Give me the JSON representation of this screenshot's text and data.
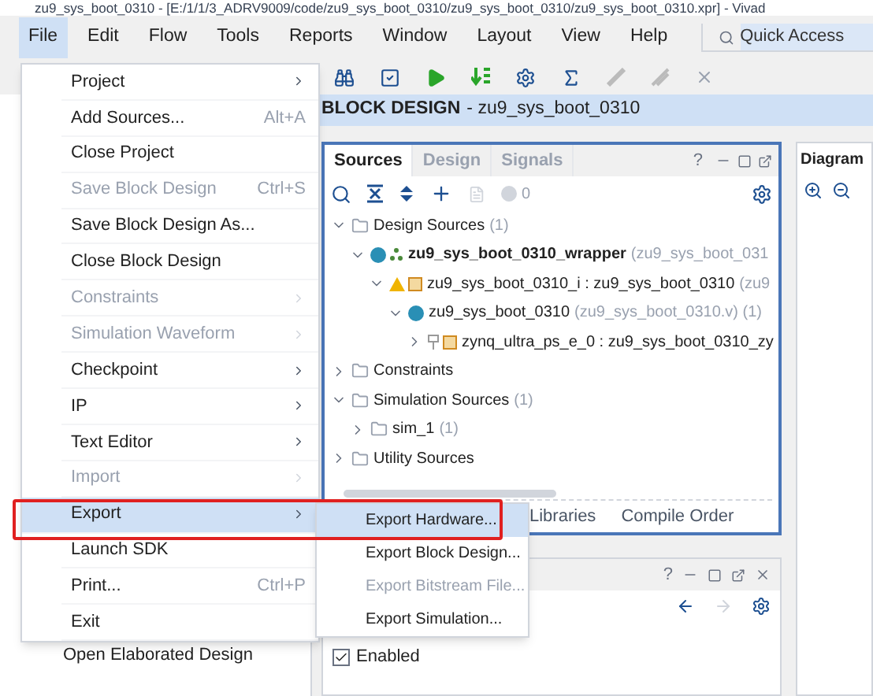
{
  "window": {
    "title": "zu9_sys_boot_0310 - [E:/1/1/3_ADRV9009/code/zu9_sys_boot_0310/zu9_sys_boot_0310/zu9_sys_boot_0310.xpr] - Vivad"
  },
  "menu_bar": [
    {
      "label": "File",
      "selected": true
    },
    {
      "label": "Edit",
      "selected": false
    },
    {
      "label": "Flow",
      "selected": false
    },
    {
      "label": "Tools",
      "selected": false
    },
    {
      "label": "Reports",
      "selected": false
    },
    {
      "label": "Window",
      "selected": false
    },
    {
      "label": "Layout",
      "selected": false
    },
    {
      "label": "View",
      "selected": false
    },
    {
      "label": "Help",
      "selected": false
    }
  ],
  "quick_access": {
    "placeholder": "Quick Access"
  },
  "block_design_header": {
    "title": "BLOCK DESIGN",
    "name": "- zu9_sys_boot_0310"
  },
  "flow_navigator": {
    "visible_item": "Open Elaborated Design"
  },
  "file_menu": [
    {
      "label": "Project",
      "submenu": true,
      "disabled": false,
      "selected": false
    },
    {
      "label": "Add Sources...",
      "shortcut": "Alt+A",
      "submenu": false,
      "disabled": false,
      "selected": false
    },
    {
      "label": "Close Project",
      "submenu": false,
      "disabled": false,
      "selected": false
    },
    {
      "label": "Save Block Design",
      "shortcut": "Ctrl+S",
      "submenu": false,
      "disabled": true,
      "selected": false
    },
    {
      "label": "Save Block Design As...",
      "submenu": false,
      "disabled": false,
      "selected": false
    },
    {
      "label": "Close Block Design",
      "submenu": false,
      "disabled": false,
      "selected": false
    },
    {
      "label": "Constraints",
      "submenu": true,
      "disabled": true,
      "selected": false
    },
    {
      "label": "Simulation Waveform",
      "submenu": true,
      "disabled": true,
      "selected": false
    },
    {
      "label": "Checkpoint",
      "submenu": true,
      "disabled": false,
      "selected": false
    },
    {
      "label": "IP",
      "submenu": true,
      "disabled": false,
      "selected": false
    },
    {
      "label": "Text Editor",
      "submenu": true,
      "disabled": false,
      "selected": false
    },
    {
      "label": "Import",
      "submenu": true,
      "disabled": true,
      "selected": false
    },
    {
      "label": "Export",
      "submenu": true,
      "disabled": false,
      "selected": true
    },
    {
      "label": "Launch SDK",
      "submenu": false,
      "disabled": false,
      "selected": false
    },
    {
      "label": "Print...",
      "shortcut": "Ctrl+P",
      "submenu": false,
      "disabled": false,
      "selected": false
    },
    {
      "label": "Exit",
      "submenu": false,
      "disabled": false,
      "selected": false
    }
  ],
  "export_submenu": [
    {
      "label": "Export Hardware...",
      "disabled": false,
      "selected": true
    },
    {
      "label": "Export Block Design...",
      "disabled": false,
      "selected": false
    },
    {
      "label": "Export Bitstream File...",
      "disabled": true,
      "selected": false
    },
    {
      "label": "Export Simulation...",
      "disabled": false,
      "selected": false
    }
  ],
  "sources_panel": {
    "tabs": [
      {
        "label": "Sources",
        "selected": true
      },
      {
        "label": "Design",
        "selected": false
      },
      {
        "label": "Signals",
        "selected": false
      }
    ],
    "help": "?",
    "issue_count": "0",
    "tree": [
      {
        "label": "Design Sources",
        "detail": "(1)",
        "kind": "folder",
        "bold": false,
        "expanded": true,
        "children": [
          {
            "label": "zu9_sys_boot_0310_wrapper",
            "detail": "(zu9_sys_boot_031",
            "kind": "top",
            "bold": true,
            "expanded": true,
            "children": [
              {
                "label": "zu9_sys_boot_0310_i : zu9_sys_boot_0310",
                "detail": "(zu9",
                "kind": "bd",
                "bold": false,
                "expanded": true,
                "children": [
                  {
                    "label": "zu9_sys_boot_0310",
                    "detail": "(zu9_sys_boot_0310.v) (1)",
                    "kind": "module",
                    "bold": false,
                    "expanded": true,
                    "children": [
                      {
                        "label": "zynq_ultra_ps_e_0 : zu9_sys_boot_0310_zy",
                        "kind": "ip",
                        "bold": false,
                        "expanded": false
                      }
                    ]
                  }
                ]
              }
            ]
          }
        ]
      },
      {
        "label": "Constraints",
        "kind": "folder",
        "bold": false,
        "expanded": false
      },
      {
        "label": "Simulation Sources",
        "detail": "(1)",
        "kind": "folder",
        "bold": false,
        "expanded": true,
        "children": [
          {
            "label": "sim_1",
            "detail": "(1)",
            "kind": "folder",
            "bold": false,
            "expanded": false
          }
        ]
      },
      {
        "label": "Utility Sources",
        "kind": "folder",
        "bold": false,
        "expanded": false
      }
    ],
    "bottom_tabs": [
      "Libraries",
      "Compile Order"
    ]
  },
  "diagram_panel": {
    "title": "Diagram"
  },
  "properties_panel": {
    "help": "?",
    "enabled": {
      "label": "Enabled",
      "checked": true
    }
  }
}
